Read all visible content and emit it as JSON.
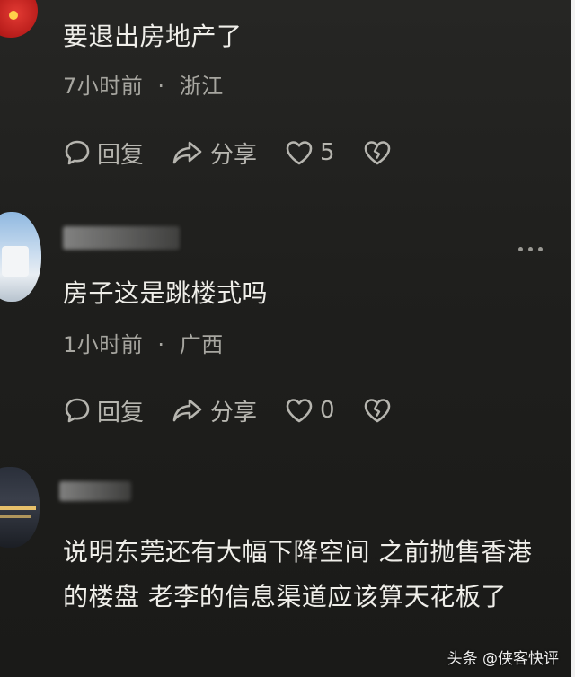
{
  "comments": [
    {
      "text": "要退出房地产了",
      "time": "7小时前",
      "location": "浙江",
      "reply_label": "回复",
      "share_label": "分享",
      "likes": "5"
    },
    {
      "text": "房子这是跳楼式吗",
      "time": "1小时前",
      "location": "广西",
      "reply_label": "回复",
      "share_label": "分享",
      "likes": "0"
    },
    {
      "text": "说明东莞还有大幅下降空间 之前抛售香港的楼盘 老李的信息渠道应该算天花板了"
    }
  ],
  "separator": "·",
  "watermark": "头条 @侠客快评",
  "icons": [
    "comment-bubble-icon",
    "share-arrow-icon",
    "heart-icon",
    "broken-heart-icon",
    "more-dots-icon"
  ],
  "colors": {
    "background": "#1c1c1a",
    "text": "#efeee9",
    "meta": "#a7a6a0",
    "accent_avatar": "#c8201e"
  }
}
